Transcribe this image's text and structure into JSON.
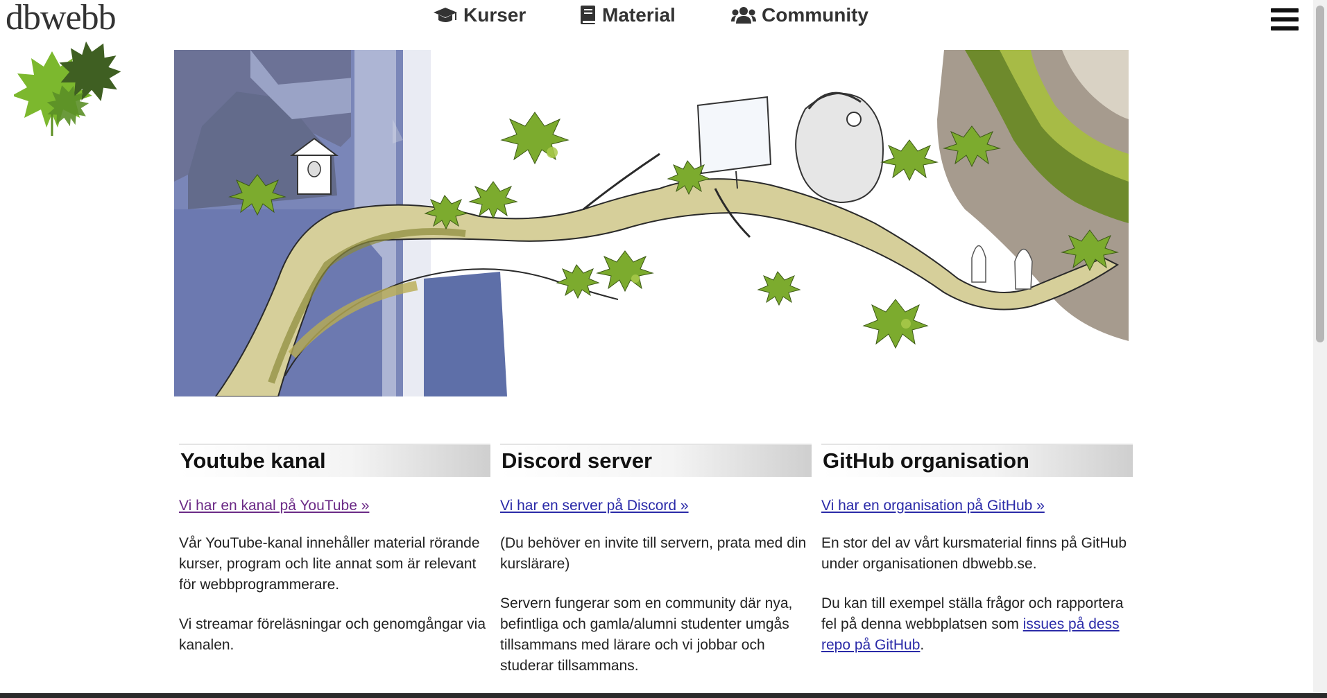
{
  "header": {
    "site_title": "dbwebb",
    "logo_icon": "maple-leaf-icon",
    "nav": [
      {
        "label": "Kurser",
        "icon": "graduation-cap-icon"
      },
      {
        "label": "Material",
        "icon": "book-icon"
      },
      {
        "label": "Community",
        "icon": "users-icon"
      }
    ],
    "menu_icon": "hamburger-menu-icon"
  },
  "hero": {
    "image": "illustration-tree-branch-computer"
  },
  "columns": [
    {
      "heading": "Youtube kanal",
      "link": "Vi har en kanal på YouTube »",
      "paragraphs": [
        "Vår YouTube-kanal innehåller material rörande kurser, program och lite annat som är relevant för webbprogrammerare.",
        "Vi streamar föreläsningar och genomgångar via kanalen."
      ]
    },
    {
      "heading": "Discord server",
      "link": "Vi har en server på Discord »",
      "paragraphs": [
        "(Du behöver en invite till servern, prata med din kurslärare)",
        "Servern fungerar som en community där nya, befintliga och gamla/alumni studenter umgås tillsammans med lärare och vi jobbar och studerar tillsammans."
      ]
    },
    {
      "heading": "GitHub organisation",
      "link": "Vi har en organisation på GitHub »",
      "paragraphs": [
        "En stor del av vårt kursmaterial finns på GitHub under organisationen dbwebb.se."
      ],
      "para2_before": "Du kan till exempel ställa frågor och rapportera fel på denna webbplatsen som ",
      "para2_link": "issues på dess repo på GitHub",
      "para2_after": "."
    }
  ],
  "colors": {
    "link": "#2a2aa8",
    "visited_link": "#6b2a86",
    "text": "#222222",
    "leaf_light": "#6aa62a",
    "leaf_dark": "#3f5f22"
  }
}
